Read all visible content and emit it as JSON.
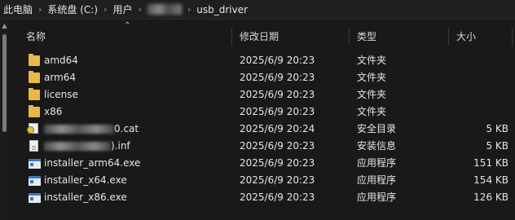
{
  "breadcrumb": {
    "items": [
      "此电脑",
      "系统盘 (C:)",
      "用户",
      "usb_driver"
    ],
    "separator": "›"
  },
  "columns": {
    "name": "名称",
    "date": "修改日期",
    "type": "类型",
    "size": "大小"
  },
  "files": [
    {
      "name": "amd64",
      "date": "2025/6/9 20:23",
      "type": "文件夹",
      "size": "",
      "icon": "folder-icon"
    },
    {
      "name": "arm64",
      "date": "2025/6/9 20:23",
      "type": "文件夹",
      "size": "",
      "icon": "folder-icon"
    },
    {
      "name": "license",
      "date": "2025/6/9 20:23",
      "type": "文件夹",
      "size": "",
      "icon": "folder-icon"
    },
    {
      "name": "x86",
      "date": "2025/6/9 20:23",
      "type": "文件夹",
      "size": "",
      "icon": "folder-icon"
    },
    {
      "name": "0.cat",
      "date": "2025/6/9 20:24",
      "type": "安全目录",
      "size": "5 KB",
      "icon": "security-catalog-icon"
    },
    {
      "name": ").inf",
      "date": "2025/6/9 20:23",
      "type": "安装信息",
      "size": "5 KB",
      "icon": "setup-info-icon"
    },
    {
      "name": "installer_arm64.exe",
      "date": "2025/6/9 20:23",
      "type": "应用程序",
      "size": "151 KB",
      "icon": "application-icon"
    },
    {
      "name": "installer_x64.exe",
      "date": "2025/6/9 20:23",
      "type": "应用程序",
      "size": "154 KB",
      "icon": "application-icon"
    },
    {
      "name": "installer_x86.exe",
      "date": "2025/6/9 20:23",
      "type": "应用程序",
      "size": "126 KB",
      "icon": "application-icon"
    }
  ]
}
